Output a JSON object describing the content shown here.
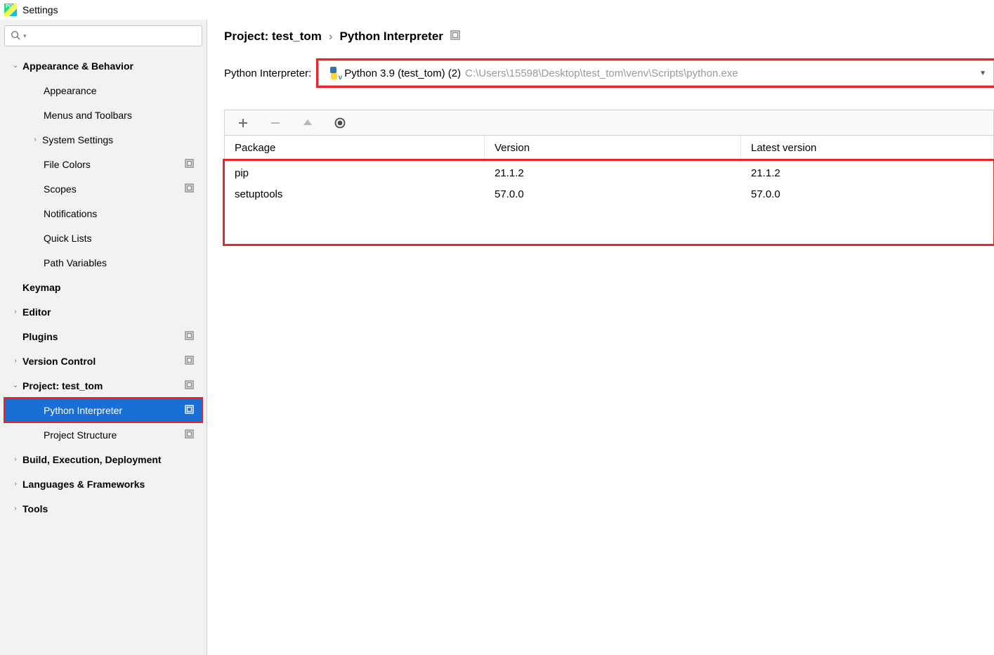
{
  "app": {
    "title": "Settings"
  },
  "sidebar": {
    "search_placeholder": "",
    "items": [
      {
        "label": "Appearance & Behavior",
        "bold": true,
        "depth": 0,
        "chev": "v",
        "proj": false,
        "sel": false,
        "hl": false
      },
      {
        "label": "Appearance",
        "bold": false,
        "depth": 1,
        "chev": "",
        "proj": false,
        "sel": false,
        "hl": false
      },
      {
        "label": "Menus and Toolbars",
        "bold": false,
        "depth": 1,
        "chev": "",
        "proj": false,
        "sel": false,
        "hl": false
      },
      {
        "label": "System Settings",
        "bold": false,
        "depth": 1,
        "chev": ">",
        "proj": false,
        "sel": false,
        "hl": false
      },
      {
        "label": "File Colors",
        "bold": false,
        "depth": 1,
        "chev": "",
        "proj": true,
        "sel": false,
        "hl": false
      },
      {
        "label": "Scopes",
        "bold": false,
        "depth": 1,
        "chev": "",
        "proj": true,
        "sel": false,
        "hl": false
      },
      {
        "label": "Notifications",
        "bold": false,
        "depth": 1,
        "chev": "",
        "proj": false,
        "sel": false,
        "hl": false
      },
      {
        "label": "Quick Lists",
        "bold": false,
        "depth": 1,
        "chev": "",
        "proj": false,
        "sel": false,
        "hl": false
      },
      {
        "label": "Path Variables",
        "bold": false,
        "depth": 1,
        "chev": "",
        "proj": false,
        "sel": false,
        "hl": false
      },
      {
        "label": "Keymap",
        "bold": true,
        "depth": 0,
        "chev": "",
        "proj": false,
        "sel": false,
        "hl": false
      },
      {
        "label": "Editor",
        "bold": true,
        "depth": 0,
        "chev": ">",
        "proj": false,
        "sel": false,
        "hl": false
      },
      {
        "label": "Plugins",
        "bold": true,
        "depth": 0,
        "chev": "",
        "proj": true,
        "sel": false,
        "hl": false
      },
      {
        "label": "Version Control",
        "bold": true,
        "depth": 0,
        "chev": ">",
        "proj": true,
        "sel": false,
        "hl": false
      },
      {
        "label": "Project: test_tom",
        "bold": true,
        "depth": 0,
        "chev": "v",
        "proj": true,
        "sel": false,
        "hl": false
      },
      {
        "label": "Python Interpreter",
        "bold": false,
        "depth": 1,
        "chev": "",
        "proj": true,
        "sel": true,
        "hl": true
      },
      {
        "label": "Project Structure",
        "bold": false,
        "depth": 1,
        "chev": "",
        "proj": true,
        "sel": false,
        "hl": false
      },
      {
        "label": "Build, Execution, Deployment",
        "bold": true,
        "depth": 0,
        "chev": ">",
        "proj": false,
        "sel": false,
        "hl": false
      },
      {
        "label": "Languages & Frameworks",
        "bold": true,
        "depth": 0,
        "chev": ">",
        "proj": false,
        "sel": false,
        "hl": false
      },
      {
        "label": "Tools",
        "bold": true,
        "depth": 0,
        "chev": ">",
        "proj": false,
        "sel": false,
        "hl": false
      }
    ]
  },
  "breadcrumb": {
    "part1": "Project: test_tom",
    "sep": "›",
    "part2": "Python Interpreter"
  },
  "interpreter": {
    "label": "Python Interpreter:",
    "name": "Python 3.9 (test_tom) (2)",
    "path": "C:\\Users\\15598\\Desktop\\test_tom\\venv\\Scripts\\python.exe"
  },
  "packages": {
    "headers": {
      "package": "Package",
      "version": "Version",
      "latest": "Latest version"
    },
    "rows": [
      {
        "name": "pip",
        "version": "21.1.2",
        "latest": "21.1.2"
      },
      {
        "name": "setuptools",
        "version": "57.0.0",
        "latest": "57.0.0"
      }
    ]
  }
}
